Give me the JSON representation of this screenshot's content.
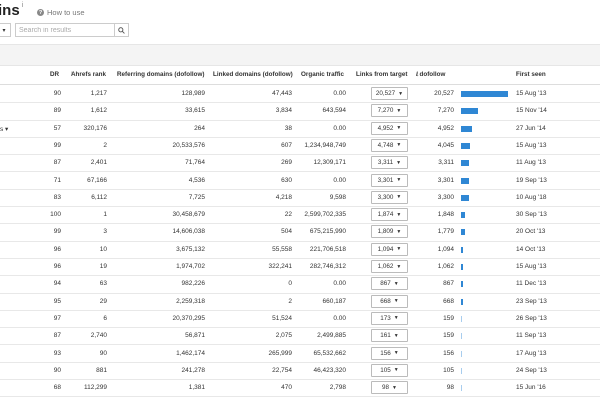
{
  "header": {
    "title": "ins",
    "title_sup": "i",
    "how_to_use": "How to use",
    "select_caret": "▾",
    "search_placeholder": "Search in results"
  },
  "columns": {
    "dr": "DR",
    "ahrefs_rank": "Ahrefs rank",
    "ref_domains": "Referring domains (dofollow)",
    "linked_domains": "Linked domains (dofollow)",
    "organic_traffic": "Organic traffic",
    "links_from_target": "Links from target",
    "dofollow": "/ dofollow",
    "dofollow_arrow": "↓",
    "first_seen": "First seen",
    "sup_i": "i"
  },
  "rows": [
    {
      "prefix": "",
      "dr": "90",
      "ahrefs_rank": "1,217",
      "ref_domains": "128,989",
      "linked_domains": "47,443",
      "organic_traffic": "0.00",
      "links": "20,527",
      "dofollow": "20,527",
      "bar_fraction": 1.0,
      "first_seen": "15 Aug '13"
    },
    {
      "prefix": "",
      "dr": "89",
      "ahrefs_rank": "1,612",
      "ref_domains": "33,615",
      "linked_domains": "3,834",
      "organic_traffic": "643,594",
      "links": "7,270",
      "dofollow": "7,270",
      "bar_fraction": 0.354,
      "first_seen": "15 Nov '14"
    },
    {
      "prefix": "s ▾",
      "dr": "57",
      "ahrefs_rank": "320,176",
      "ref_domains": "264",
      "linked_domains": "38",
      "organic_traffic": "0.00",
      "links": "4,952",
      "dofollow": "4,952",
      "bar_fraction": 0.241,
      "first_seen": "27 Jun '14"
    },
    {
      "prefix": "",
      "dr": "99",
      "ahrefs_rank": "2",
      "ref_domains": "20,533,576",
      "linked_domains": "607",
      "organic_traffic": "1,234,948,749",
      "links": "4,748",
      "dofollow": "4,045",
      "bar_fraction": 0.197,
      "first_seen": "15 Aug '13"
    },
    {
      "prefix": "",
      "dr": "87",
      "ahrefs_rank": "2,401",
      "ref_domains": "71,764",
      "linked_domains": "269",
      "organic_traffic": "12,309,171",
      "links": "3,311",
      "dofollow": "3,311",
      "bar_fraction": 0.161,
      "first_seen": "11 Aug '13"
    },
    {
      "prefix": "",
      "dr": "71",
      "ahrefs_rank": "67,166",
      "ref_domains": "4,536",
      "linked_domains": "630",
      "organic_traffic": "0.00",
      "links": "3,301",
      "dofollow": "3,301",
      "bar_fraction": 0.161,
      "first_seen": "19 Sep '13"
    },
    {
      "prefix": "",
      "dr": "83",
      "ahrefs_rank": "6,112",
      "ref_domains": "7,725",
      "linked_domains": "4,218",
      "organic_traffic": "9,598",
      "links": "3,300",
      "dofollow": "3,300",
      "bar_fraction": 0.161,
      "first_seen": "10 Aug '18"
    },
    {
      "prefix": "",
      "dr": "100",
      "ahrefs_rank": "1",
      "ref_domains": "30,458,679",
      "linked_domains": "22",
      "organic_traffic": "2,599,702,335",
      "links": "1,874",
      "dofollow": "1,848",
      "bar_fraction": 0.09,
      "first_seen": "30 Sep '13"
    },
    {
      "prefix": "",
      "dr": "99",
      "ahrefs_rank": "3",
      "ref_domains": "14,606,038",
      "linked_domains": "504",
      "organic_traffic": "675,215,990",
      "links": "1,809",
      "dofollow": "1,779",
      "bar_fraction": 0.087,
      "first_seen": "20 Oct '13"
    },
    {
      "prefix": "",
      "dr": "96",
      "ahrefs_rank": "10",
      "ref_domains": "3,675,132",
      "linked_domains": "55,558",
      "organic_traffic": "221,706,518",
      "links": "1,094",
      "dofollow": "1,094",
      "bar_fraction": 0.053,
      "first_seen": "14 Oct '13"
    },
    {
      "prefix": "",
      "dr": "96",
      "ahrefs_rank": "19",
      "ref_domains": "1,974,702",
      "linked_domains": "322,241",
      "organic_traffic": "282,746,312",
      "links": "1,062",
      "dofollow": "1,062",
      "bar_fraction": 0.052,
      "first_seen": "15 Aug '13"
    },
    {
      "prefix": "",
      "dr": "94",
      "ahrefs_rank": "63",
      "ref_domains": "982,226",
      "linked_domains": "0",
      "organic_traffic": "0.00",
      "links": "867",
      "dofollow": "867",
      "bar_fraction": 0.042,
      "first_seen": "11 Dec '13"
    },
    {
      "prefix": "",
      "dr": "95",
      "ahrefs_rank": "29",
      "ref_domains": "2,259,318",
      "linked_domains": "2",
      "organic_traffic": "660,187",
      "links": "668",
      "dofollow": "668",
      "bar_fraction": 0.033,
      "first_seen": "23 Sep '13"
    },
    {
      "prefix": "",
      "dr": "97",
      "ahrefs_rank": "6",
      "ref_domains": "20,370,295",
      "linked_domains": "51,524",
      "organic_traffic": "0.00",
      "links": "173",
      "dofollow": "159",
      "bar_fraction": 0.008,
      "first_seen": "26 Sep '13"
    },
    {
      "prefix": "",
      "dr": "87",
      "ahrefs_rank": "2,740",
      "ref_domains": "56,871",
      "linked_domains": "2,075",
      "organic_traffic": "2,499,885",
      "links": "161",
      "dofollow": "159",
      "bar_fraction": 0.008,
      "first_seen": "11 Sep '13"
    },
    {
      "prefix": "",
      "dr": "93",
      "ahrefs_rank": "90",
      "ref_domains": "1,462,174",
      "linked_domains": "265,999",
      "organic_traffic": "65,532,662",
      "links": "156",
      "dofollow": "156",
      "bar_fraction": 0.008,
      "first_seen": "17 Aug '13"
    },
    {
      "prefix": "",
      "dr": "90",
      "ahrefs_rank": "881",
      "ref_domains": "241,278",
      "linked_domains": "22,754",
      "organic_traffic": "46,423,320",
      "links": "105",
      "dofollow": "105",
      "bar_fraction": 0.005,
      "first_seen": "24 Sep '13"
    },
    {
      "prefix": "",
      "dr": "68",
      "ahrefs_rank": "112,299",
      "ref_domains": "1,381",
      "linked_domains": "470",
      "organic_traffic": "2,798",
      "links": "98",
      "dofollow": "98",
      "bar_fraction": 0.005,
      "first_seen": "15 Jun '16"
    }
  ],
  "colors": {
    "bar": "#2f87d4"
  }
}
